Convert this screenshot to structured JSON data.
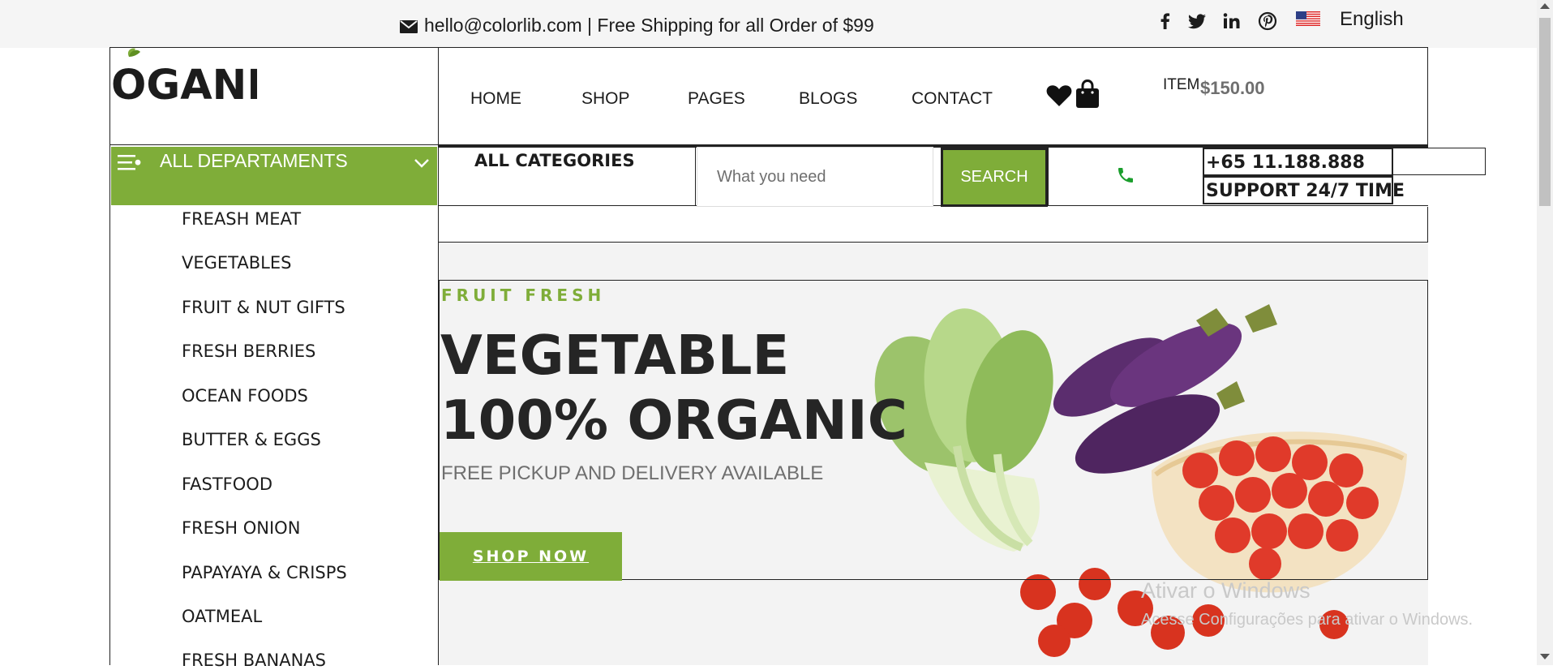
{
  "topbar": {
    "contact": "hello@colorlib.com | Free Shipping for all Order of $99",
    "social_icons": [
      "facebook-icon",
      "twitter-icon",
      "linkedin-icon",
      "pinterest-icon"
    ],
    "language": "English"
  },
  "header": {
    "logo": "OGANI",
    "nav": [
      "HOME",
      "SHOP",
      "PAGES",
      "BLOGS",
      "CONTACT"
    ],
    "item_label": "ITEM",
    "item_price": "$150.00"
  },
  "departments": {
    "title": "ALL DEPARTAMENTS",
    "items": [
      "FREASH MEAT",
      "VEGETABLES",
      "FRUIT & NUT GIFTS",
      "FRESH BERRIES",
      "OCEAN FOODS",
      "BUTTER & EGGS",
      "FASTFOOD",
      "FRESH ONION",
      "PAPAYAYA & CRISPS",
      "OATMEAL",
      "FRESH BANANAS"
    ]
  },
  "search": {
    "categories_label": "ALL CATEGORIES",
    "placeholder": "What you need",
    "button": "SEARCH"
  },
  "support": {
    "phone": "+65 11.188.888",
    "text": "SUPPORT 24/7 TIME"
  },
  "hero": {
    "kicker": "FRUIT FRESH",
    "title_line1": "VEGETABLE",
    "title_line2": "100% ORGANIC",
    "subtitle": "FREE PICKUP AND DELIVERY AVAILABLE",
    "button": "SHOP NOW"
  },
  "watermark": {
    "line1": "Ativar o Windows",
    "line2": "Acesse Configurações para ativar o Windows."
  },
  "colors": {
    "accent": "#7fad39",
    "phone_icon": "#1a9e2c"
  }
}
